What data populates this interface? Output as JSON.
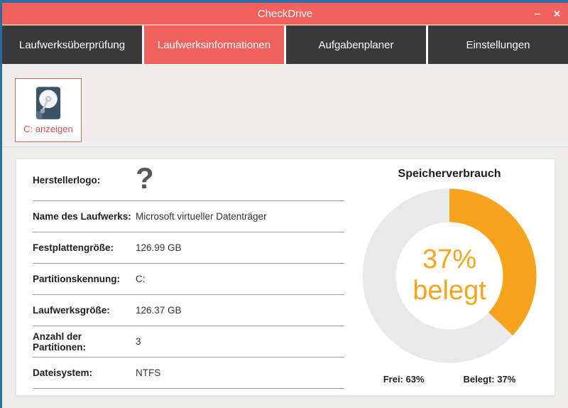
{
  "window": {
    "title": "CheckDrive",
    "minimize_glyph": "–",
    "close_glyph": "✕"
  },
  "tabs": [
    {
      "label": "Laufwerksüberprüfung",
      "active": false
    },
    {
      "label": "Laufwerksinformationen",
      "active": true
    },
    {
      "label": "Aufgabenplaner",
      "active": false
    },
    {
      "label": "Einstellungen",
      "active": false
    }
  ],
  "toolbar": {
    "drive_button_label": "C: anzeigen",
    "drive_icon": "hard-drive-icon"
  },
  "info_table": {
    "rows": [
      {
        "label": "Herstellerlogo:",
        "value": "?"
      },
      {
        "label": "Name des Laufwerks:",
        "value": "Microsoft virtueller Datenträger"
      },
      {
        "label": "Festplattengröße:",
        "value": "126.99 GB"
      },
      {
        "label": "Partitionskennung:",
        "value": "C:"
      },
      {
        "label": "Laufwerksgröße:",
        "value": "126.37 GB"
      },
      {
        "label": "Anzahl der Partitionen:",
        "value": "3"
      },
      {
        "label": "Dateisystem:",
        "value": "NTFS"
      }
    ]
  },
  "chart_data": {
    "type": "pie",
    "variant": "donut",
    "title": "Speicherverbrauch",
    "center_label_value": "37%",
    "center_label_text": "belegt",
    "slices": [
      {
        "name": "Belegt",
        "value": 37,
        "color": "#F6A41E"
      },
      {
        "name": "Frei",
        "value": 63,
        "color": "#E9E9E9"
      }
    ],
    "legend": [
      {
        "label": "Frei:",
        "value": "63%"
      },
      {
        "label": "Belegt:",
        "value": "37%"
      }
    ],
    "legend_position": "bottom"
  },
  "colors": {
    "titlebar_red": "#F4615D",
    "tab_dark": "#3A3939",
    "window_border_blue": "#2A6DA3",
    "background_gray": "#EFEEED",
    "used_orange": "#F6A41E",
    "free_ring_gray": "#E9E9E9",
    "button_text_red": "#D05045"
  }
}
